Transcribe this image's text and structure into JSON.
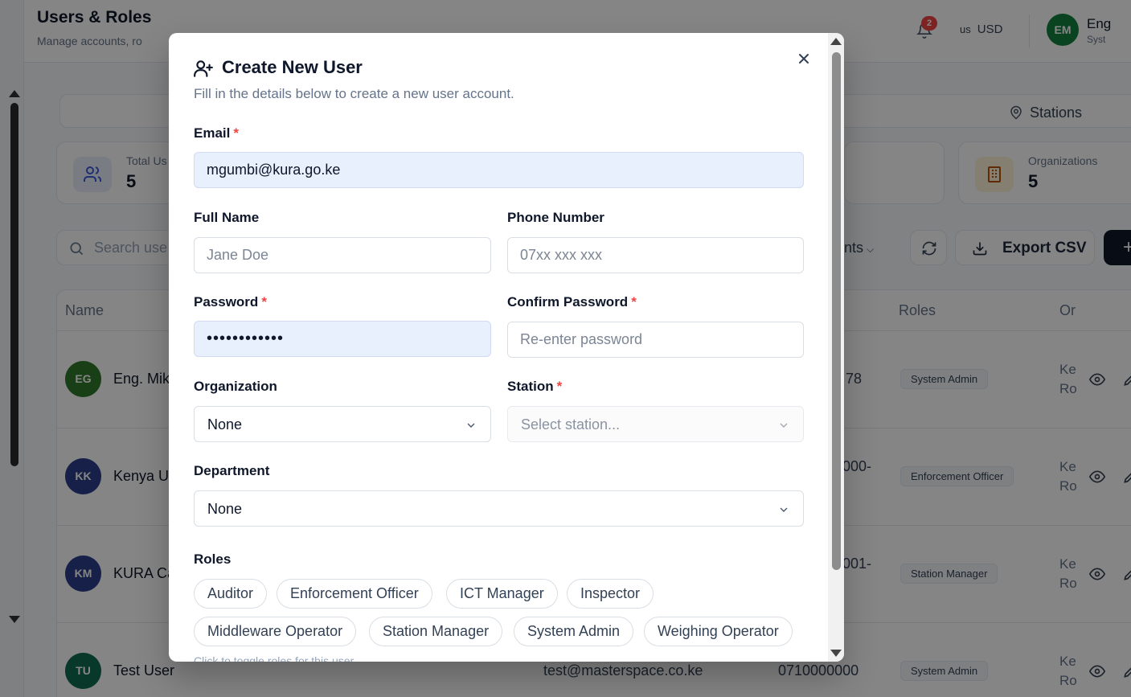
{
  "page": {
    "title": "Users & Roles",
    "subtitle": "Manage accounts, ro",
    "notifications_count": "2",
    "currency_flag": "us",
    "currency": "USD",
    "user_initials": "EM",
    "user_name": "Eng",
    "user_role": "Syst",
    "stations_filter": "Stations",
    "stats": [
      {
        "label": "Total Us",
        "value": "5"
      },
      {
        "label": "Organizations",
        "value": "5"
      }
    ],
    "search_placeholder": "Search use",
    "dept_filter": "ents",
    "export_label": "Export CSV",
    "table_headers": {
      "name": "Name",
      "roles": "Roles",
      "org": "Or"
    },
    "rows": [
      {
        "initials": "EG",
        "name": "Eng. Mik",
        "email": "",
        "phone": "78",
        "role": "System Admin",
        "org1": "Ke",
        "org2": "Ro",
        "avatar_color": "#2f7a2a"
      },
      {
        "initials": "KK",
        "name": "Kenya U",
        "email": "",
        "phone": "000-",
        "role": "Enforcement Officer",
        "org1": "Ke",
        "org2": "Ro",
        "avatar_color": "#2b3f8a"
      },
      {
        "initials": "KM",
        "name": "KURA Ca",
        "email": "",
        "phone": "001-",
        "role": "Station Manager",
        "org1": "Ke",
        "org2": "Ro",
        "avatar_color": "#2b3f8a"
      },
      {
        "initials": "TU",
        "name": "Test User",
        "email": "test@masterspace.co.ke",
        "phone": "0710000000",
        "role": "System Admin",
        "org1": "Ke",
        "org2": "Ro",
        "avatar_color": "#0f6b4f"
      }
    ]
  },
  "modal": {
    "title": "Create New User",
    "description": "Fill in the details below to create a new user account.",
    "email_label": "Email",
    "email_value": "mgumbi@kura.go.ke",
    "fullname_label": "Full Name",
    "fullname_placeholder": "Jane Doe",
    "phone_label": "Phone Number",
    "phone_placeholder": "07xx xxx xxx",
    "password_label": "Password",
    "password_value": "Password123!",
    "confirm_label": "Confirm Password",
    "confirm_placeholder": "Re-enter password",
    "organization_label": "Organization",
    "organization_value": "None",
    "station_label": "Station",
    "station_value": "Select station...",
    "department_label": "Department",
    "department_value": "None",
    "roles_label": "Roles",
    "roles": [
      "Auditor",
      "Enforcement Officer",
      "ICT Manager",
      "Inspector",
      "Middleware Operator",
      "Station Manager",
      "System Admin",
      "Weighing Operator"
    ],
    "roles_hint": "Click to toggle roles for this user",
    "required_mark": "*"
  },
  "colors": {
    "primary": "#0f172a",
    "required": "#ef4444",
    "autofill_bg": "#e8effd",
    "muted_text": "#64748b"
  }
}
